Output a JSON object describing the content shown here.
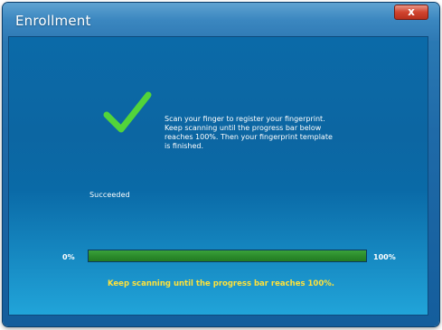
{
  "window": {
    "title": "Enrollment",
    "close_label": "x"
  },
  "status": {
    "icon": "checkmark-icon",
    "text": "Succeeded",
    "check_color": "#52d43a"
  },
  "instructions": [
    "Scan your finger to register your fingerprint.",
    "Keep scanning until the progress bar below",
    "reaches 100%.  Then your fingerprint template",
    "is finished."
  ],
  "progress": {
    "min_label": "0%",
    "max_label": "100%",
    "value": 1.0,
    "fill_color": "#2c8c2c"
  },
  "footer": {
    "message": "Keep scanning until the progress bar reaches 100%."
  }
}
